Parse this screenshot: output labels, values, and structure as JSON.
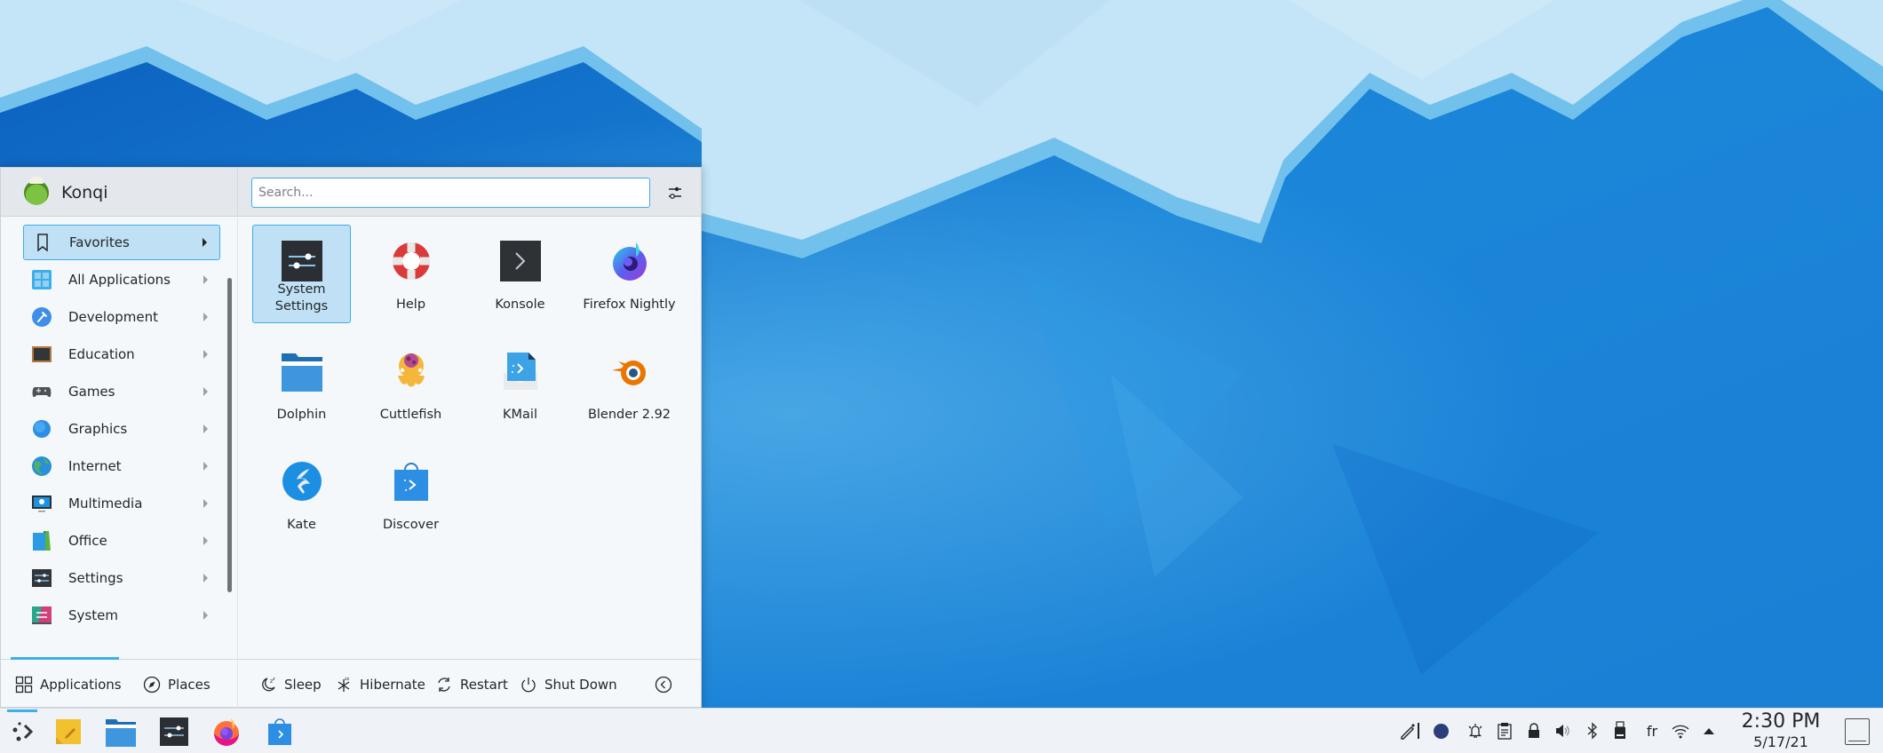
{
  "desktop": {
    "colors": {
      "sky": "#c3e3f7",
      "band": "#72c1ec",
      "deep": "#0f6ec7",
      "mid": "#1d93e0"
    }
  },
  "menu": {
    "user": {
      "name": "Konqi",
      "avatar": "konqi-avatar"
    },
    "search": {
      "placeholder": "Search...",
      "value": ""
    },
    "filter_icon": "configure-icon",
    "categories": [
      {
        "label": "Favorites",
        "icon": "bookmark-icon",
        "active": true
      },
      {
        "label": "All Applications",
        "icon": "all-apps-icon",
        "active": false
      },
      {
        "label": "Development",
        "icon": "development-icon",
        "active": false
      },
      {
        "label": "Education",
        "icon": "education-icon",
        "active": false
      },
      {
        "label": "Games",
        "icon": "gamepad-icon",
        "active": false
      },
      {
        "label": "Graphics",
        "icon": "graphics-icon",
        "active": false
      },
      {
        "label": "Internet",
        "icon": "globe-icon",
        "active": false
      },
      {
        "label": "Multimedia",
        "icon": "multimedia-icon",
        "active": false
      },
      {
        "label": "Office",
        "icon": "office-icon",
        "active": false
      },
      {
        "label": "Settings",
        "icon": "settings-icon",
        "active": false
      },
      {
        "label": "System",
        "icon": "system-icon",
        "active": false
      }
    ],
    "apps": [
      {
        "label": "System Settings",
        "icon": "system-settings-icon",
        "active": true
      },
      {
        "label": "Help",
        "icon": "help-lifebuoy-icon",
        "active": false
      },
      {
        "label": "Konsole",
        "icon": "konsole-icon",
        "active": false
      },
      {
        "label": "Firefox Nightly",
        "icon": "firefox-nightly-icon",
        "active": false
      },
      {
        "label": "Dolphin",
        "icon": "dolphin-folder-icon",
        "active": false
      },
      {
        "label": "Cuttlefish",
        "icon": "cuttlefish-icon",
        "active": false
      },
      {
        "label": "KMail",
        "icon": "kmail-icon",
        "active": false
      },
      {
        "label": "Blender 2.92",
        "icon": "blender-icon",
        "active": false
      },
      {
        "label": "Kate",
        "icon": "kate-icon",
        "active": false
      },
      {
        "label": "Discover",
        "icon": "discover-icon",
        "active": false
      }
    ],
    "footer": {
      "tabs": [
        {
          "label": "Applications",
          "icon": "applications-grid-icon",
          "active": true
        },
        {
          "label": "Places",
          "icon": "compass-icon",
          "active": false
        }
      ],
      "power": [
        {
          "label": "Sleep",
          "icon": "sleep-icon"
        },
        {
          "label": "Hibernate",
          "icon": "hibernate-icon"
        },
        {
          "label": "Restart",
          "icon": "restart-icon"
        },
        {
          "label": "Shut Down",
          "icon": "shutdown-icon"
        }
      ],
      "leave_icon": "leave-icon"
    }
  },
  "taskbar": {
    "tasks": [
      {
        "name": "application-launcher",
        "icon": "kde-launcher-icon"
      },
      {
        "name": "notes",
        "icon": "notes-icon"
      },
      {
        "name": "dolphin",
        "icon": "dolphin-folder-icon"
      },
      {
        "name": "system-settings",
        "icon": "system-settings-icon"
      },
      {
        "name": "firefox",
        "icon": "firefox-icon"
      },
      {
        "name": "discover",
        "icon": "discover-icon"
      }
    ],
    "tray": [
      {
        "name": "color-picker",
        "icon": "color-picker-icon"
      },
      {
        "name": "color-swatch",
        "icon": "color-swatch-icon",
        "color": "#2c3e7a"
      },
      {
        "name": "notifications",
        "icon": "bell-icon"
      },
      {
        "name": "clipboard",
        "icon": "clipboard-icon"
      },
      {
        "name": "lock",
        "icon": "lock-icon"
      },
      {
        "name": "volume",
        "icon": "volume-icon"
      },
      {
        "name": "bluetooth",
        "icon": "bluetooth-icon"
      },
      {
        "name": "usb-device",
        "icon": "usb-icon"
      },
      {
        "name": "keyboard-layout",
        "label": "fr"
      },
      {
        "name": "network",
        "icon": "wifi-icon"
      },
      {
        "name": "expand",
        "icon": "arrow-up-icon"
      }
    ],
    "clock": {
      "time": "2:30 PM",
      "date": "5/17/21"
    },
    "show_desktop_icon": "show-desktop-icon"
  }
}
